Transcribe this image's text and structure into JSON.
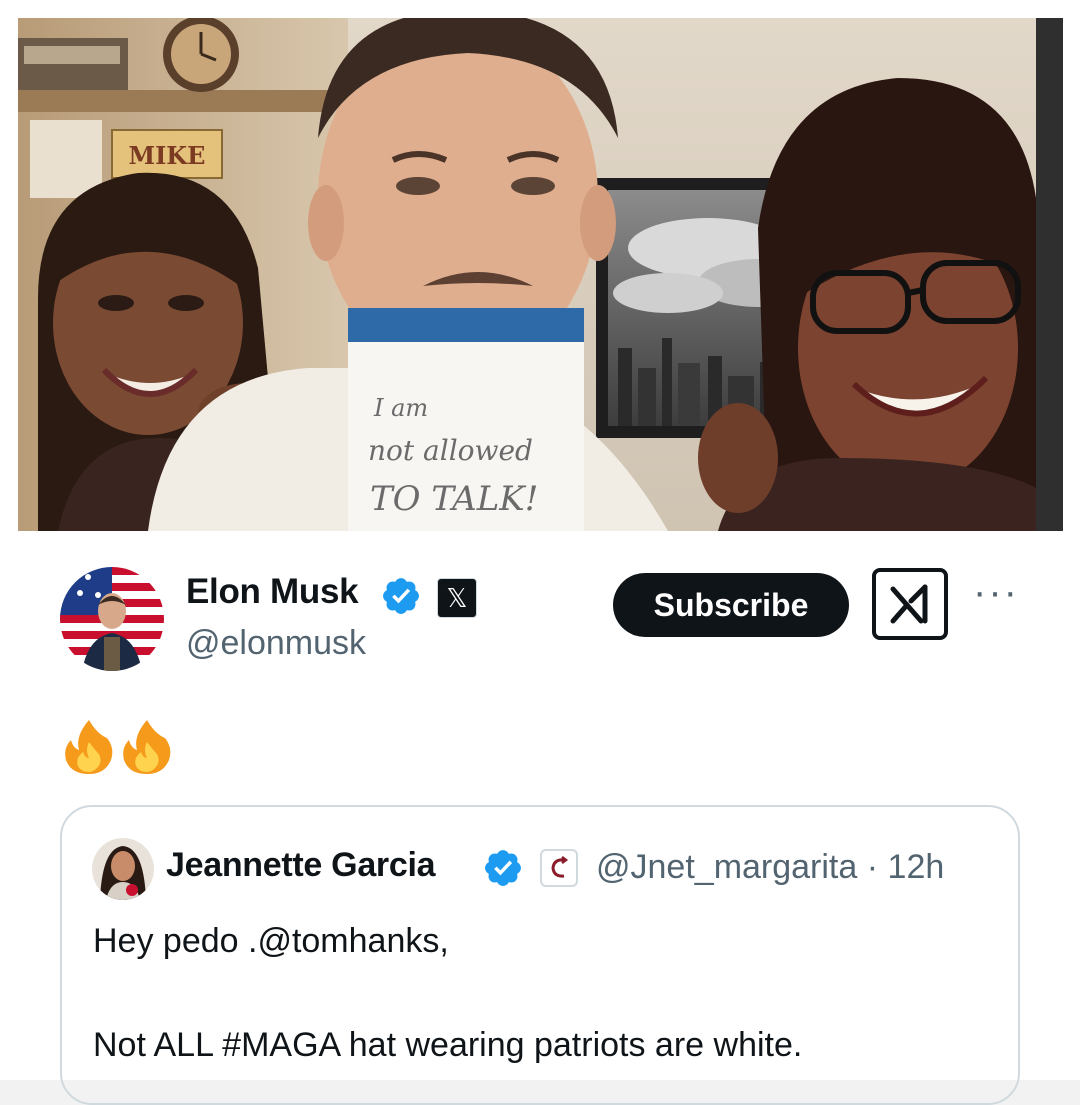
{
  "photo": {
    "wall_sign": "MIKE",
    "note_lines": [
      "I am",
      "not allowed",
      "TO TALK!"
    ]
  },
  "post": {
    "author": {
      "name": "Elon Musk",
      "handle": "@elonmusk",
      "verified_icon": "verified-badge-icon",
      "affiliate_icon": "x-logo-icon"
    },
    "subscribe_label": "Subscribe",
    "grok_icon": "grok-icon",
    "more_label": "···",
    "text_emojis": [
      "🔥",
      "🔥"
    ],
    "colors": {
      "verified": "#1d9bf0",
      "button_dark": "#0f1419",
      "muted": "#536471",
      "border": "#cfd9de"
    }
  },
  "quote": {
    "author": {
      "name": "Jeannette Garcia",
      "handle": "@Jnet_margarita",
      "time": "12h",
      "separator": "·",
      "verified_icon": "verified-badge-icon",
      "affiliate_icon": "affiliate-badge-icon"
    },
    "text": "Hey pedo .@tomhanks,\n\nNot ALL #MAGA hat wearing patriots are white."
  }
}
